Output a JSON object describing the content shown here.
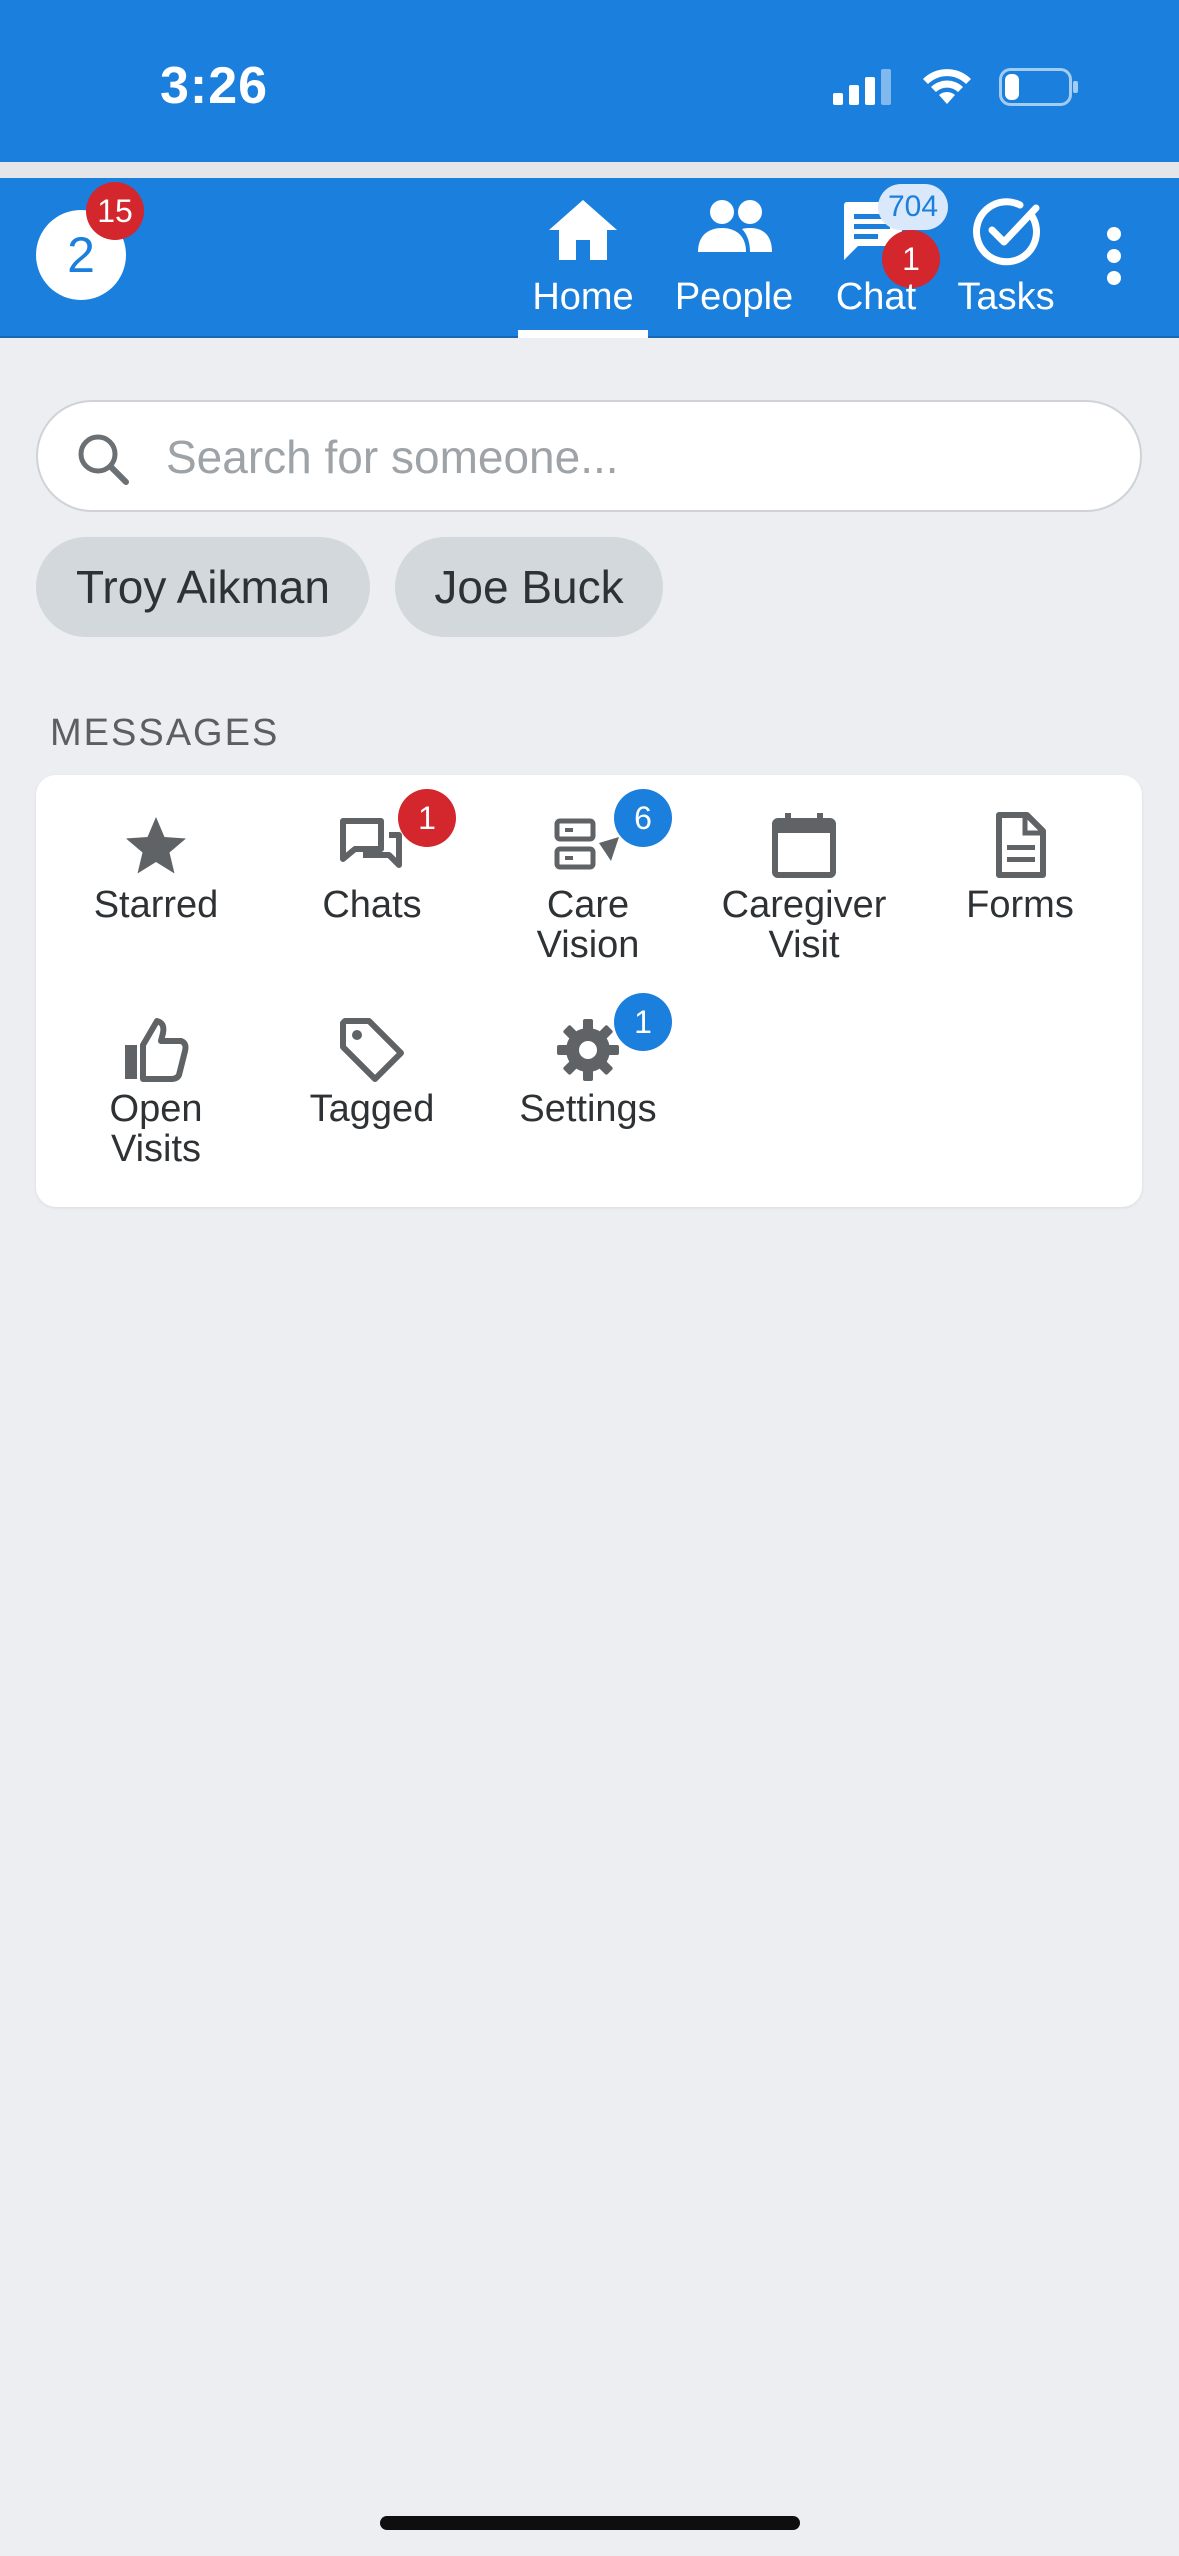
{
  "status_bar": {
    "time": "3:26"
  },
  "app_bar": {
    "avatar_initial": "2",
    "avatar_badge": "15",
    "tabs": [
      {
        "label": "Home",
        "icon": "home-icon",
        "active": true
      },
      {
        "label": "People",
        "icon": "people-icon",
        "active": false
      },
      {
        "label": "Chat",
        "icon": "chat-icon",
        "active": false,
        "count": "704",
        "badge": "1"
      },
      {
        "label": "Tasks",
        "icon": "tasks-check-icon",
        "active": false
      }
    ]
  },
  "search": {
    "placeholder": "Search for someone..."
  },
  "chips": [
    {
      "label": "Troy Aikman"
    },
    {
      "label": "Joe Buck"
    }
  ],
  "messages": {
    "header": "MESSAGES",
    "tiles": [
      {
        "label": "Starred",
        "icon": "star-icon"
      },
      {
        "label": "Chats",
        "icon": "chats-icon",
        "badge": "1",
        "badge_color": "#d3262d"
      },
      {
        "label": "Care\nVision",
        "icon": "care-vision-icon",
        "badge": "6",
        "badge_color": "#1b7fde"
      },
      {
        "label": "Caregiver\nVisit",
        "icon": "calendar-icon"
      },
      {
        "label": "Forms",
        "icon": "document-icon"
      },
      {
        "label": "Open\nVisits",
        "icon": "thumbs-up-icon"
      },
      {
        "label": "Tagged",
        "icon": "tag-icon"
      },
      {
        "label": "Settings",
        "icon": "gear-icon",
        "badge": "1",
        "badge_color": "#1b7fde"
      }
    ]
  },
  "colors": {
    "primary": "#1b7fde",
    "badge_red": "#d3262d",
    "background": "#eceef1",
    "chip": "#d2d8dc"
  }
}
